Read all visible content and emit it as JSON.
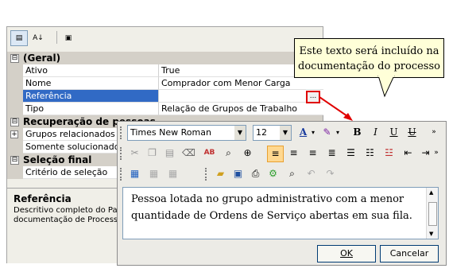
{
  "property_grid": {
    "toolbar": {
      "categorized_glyph": "▤",
      "sort_glyph": "A↓",
      "pages_glyph": "▣"
    },
    "categories": [
      {
        "label": "(Geral)",
        "expander": "⊟"
      },
      {
        "label": "Recuperação de pessoas",
        "expander": "⊟"
      },
      {
        "label": "Seleção final",
        "expander": "⊟"
      }
    ],
    "general": [
      {
        "name": "Ativo",
        "value": "True"
      },
      {
        "name": "Nome",
        "value": "Comprador com Menor Carga"
      },
      {
        "name": "Referência",
        "value": ""
      },
      {
        "name": "Tipo",
        "value": "Relação de Grupos de Trabalho"
      }
    ],
    "recovery": [
      {
        "name": "Grupos relacionados",
        "expander": "+"
      },
      {
        "name": "Somente solucionadores"
      }
    ],
    "final_selection": [
      {
        "name": "Critério de seleção"
      }
    ],
    "ellipsis_label": "...",
    "description": {
      "title": "Referência",
      "text_line1": "Descritivo completo do Pape",
      "text_line2": "documentação de Processo"
    }
  },
  "callout": {
    "text": "Este texto será incluído na documentação do processo"
  },
  "editor_dialog": {
    "font_name": "Times New Roman",
    "font_size": "12",
    "format_buttons": {
      "bold": "B",
      "italic": "I",
      "underline": "U",
      "strike": "U"
    },
    "content": "Pessoa lotada no grupo administrativo com a menor quantidade de Ordens de Serviço abertas em sua fila.",
    "ok_label": "OK",
    "cancel_label": "Cancelar"
  }
}
